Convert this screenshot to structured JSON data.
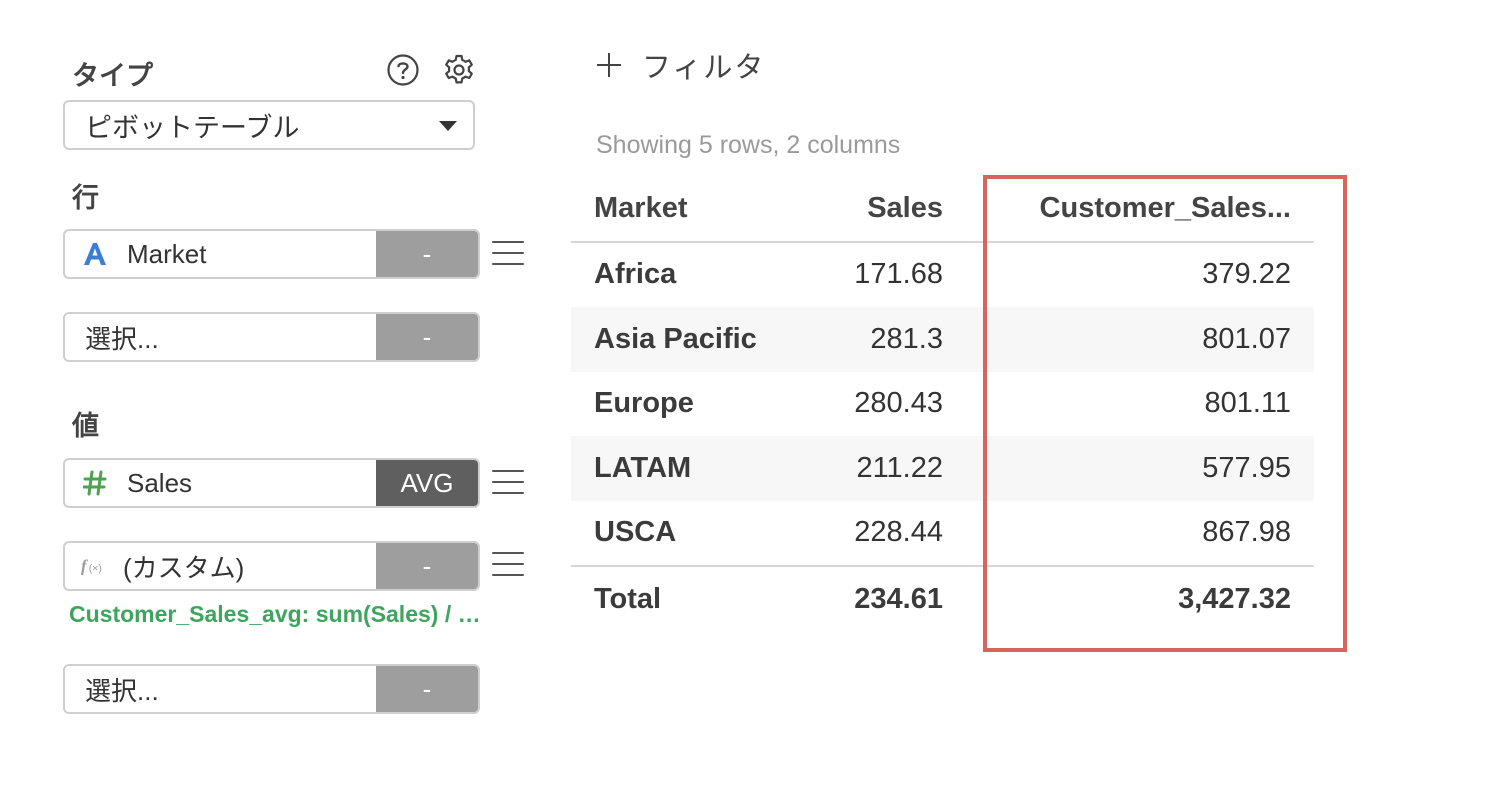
{
  "sidebar": {
    "type_label": "タイプ",
    "type_select": "ピボットテーブル",
    "rows_label": "行",
    "row_fields": [
      {
        "icon": "text-type-icon",
        "glyph": "A",
        "name": "Market",
        "agg": "-"
      },
      {
        "icon": "",
        "glyph": "",
        "name": "選択...",
        "agg": "-"
      }
    ],
    "values_label": "値",
    "value_fields": [
      {
        "icon": "number-type-icon",
        "glyph": "#",
        "name": "Sales",
        "agg": "AVG"
      },
      {
        "icon": "function-icon",
        "glyph": "f(x)",
        "name": "(カスタム)",
        "agg": "-"
      },
      {
        "icon": "",
        "glyph": "",
        "name": "選択...",
        "agg": "-"
      }
    ],
    "custom_formula": "Customer_Sales_avg: sum(Sales) / …"
  },
  "main": {
    "filter_label": "フィルタ",
    "summary": "Showing 5 rows, 2 columns"
  },
  "table": {
    "headers": [
      "Market",
      "Sales",
      "Customer_Sales..."
    ],
    "rows": [
      [
        "Africa",
        "171.68",
        "379.22"
      ],
      [
        "Asia Pacific",
        "281.3",
        "801.07"
      ],
      [
        "Europe",
        "280.43",
        "801.11"
      ],
      [
        "LATAM",
        "211.22",
        "577.95"
      ],
      [
        "USCA",
        "228.44",
        "867.98"
      ]
    ],
    "total": [
      "Total",
      "234.61",
      "3,427.32"
    ]
  },
  "colors": {
    "highlight_border": "#d9645c",
    "formula_green": "#3da55d",
    "text_type_blue": "#3b7fd4",
    "number_type_green": "#4ea24e",
    "agg_gray": "#9e9e9e",
    "agg_dark": "#5f5f5f"
  }
}
